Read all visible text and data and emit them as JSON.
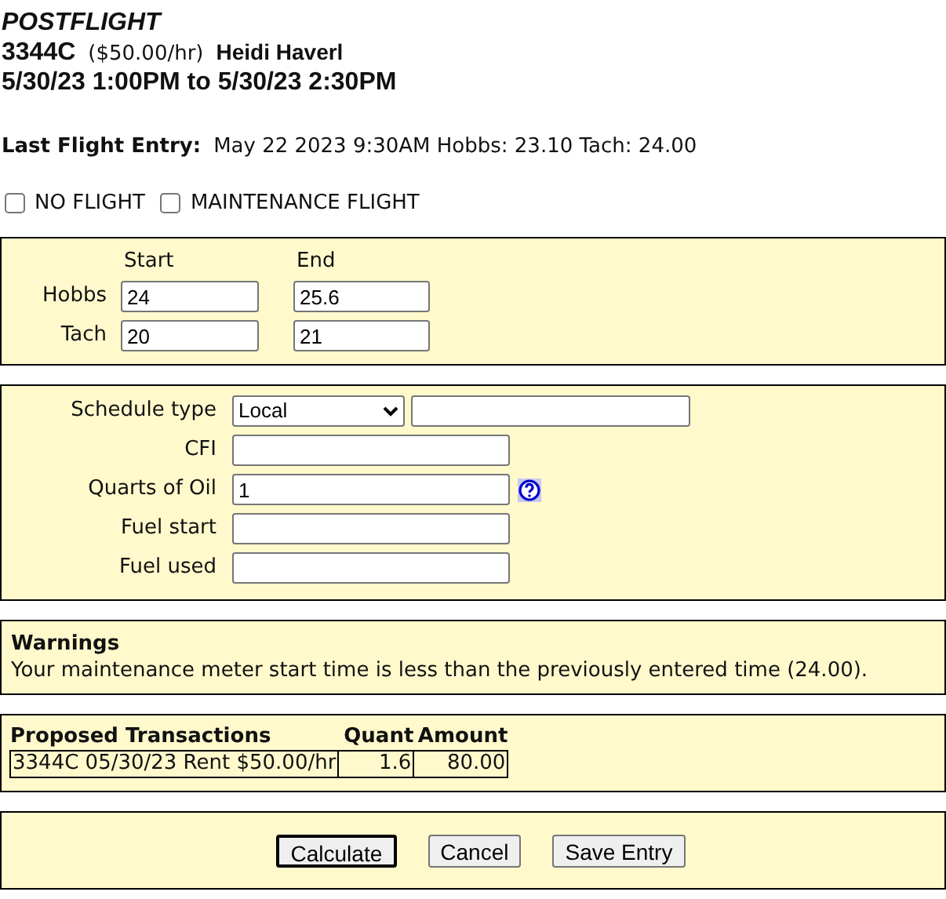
{
  "header": {
    "title": "POSTFLIGHT",
    "aircraft": "3344C",
    "rate": "($50.00/hr)",
    "pilot": "Heidi Haverl",
    "period": "5/30/23 1:00PM to 5/30/23 2:30PM"
  },
  "last_entry": {
    "label": "Last Flight Entry:",
    "value": "May 22 2023 9:30AM Hobbs: 23.10 Tach: 24.00"
  },
  "options": [
    {
      "label": "NO FLIGHT",
      "checked": false
    },
    {
      "label": "MAINTENANCE FLIGHT",
      "checked": false
    }
  ],
  "meters": {
    "columns": [
      "Start",
      "End"
    ],
    "rows": [
      {
        "label": "Hobbs",
        "start": "24",
        "end": "25.6"
      },
      {
        "label": "Tach",
        "start": "20",
        "end": "21"
      }
    ]
  },
  "details": [
    {
      "kind": "select",
      "label": "Schedule type",
      "value": "Local"
    },
    {
      "kind": "text",
      "label": "CFI"
    },
    {
      "kind": "help",
      "label": "Quarts of Oil",
      "value": "1"
    },
    {
      "kind": "text",
      "label": "Fuel start"
    },
    {
      "kind": "text",
      "label": "Fuel used"
    }
  ],
  "warnings": {
    "title": "Warnings",
    "message": "Your maintenance meter start time is less than the previously entered time (24.00)."
  },
  "transactions": {
    "columns": [
      "Proposed Transactions",
      "Quant",
      "Amount"
    ],
    "rows": [
      {
        "description": "3344C 05/30/23 Rent $50.00/hr",
        "quant": "1.6",
        "amount": "80.00"
      }
    ]
  },
  "buttons": [
    {
      "label": "Calculate",
      "focused": true
    },
    {
      "label": "Cancel",
      "focused": false
    },
    {
      "label": "Save Entry",
      "focused": false
    }
  ]
}
